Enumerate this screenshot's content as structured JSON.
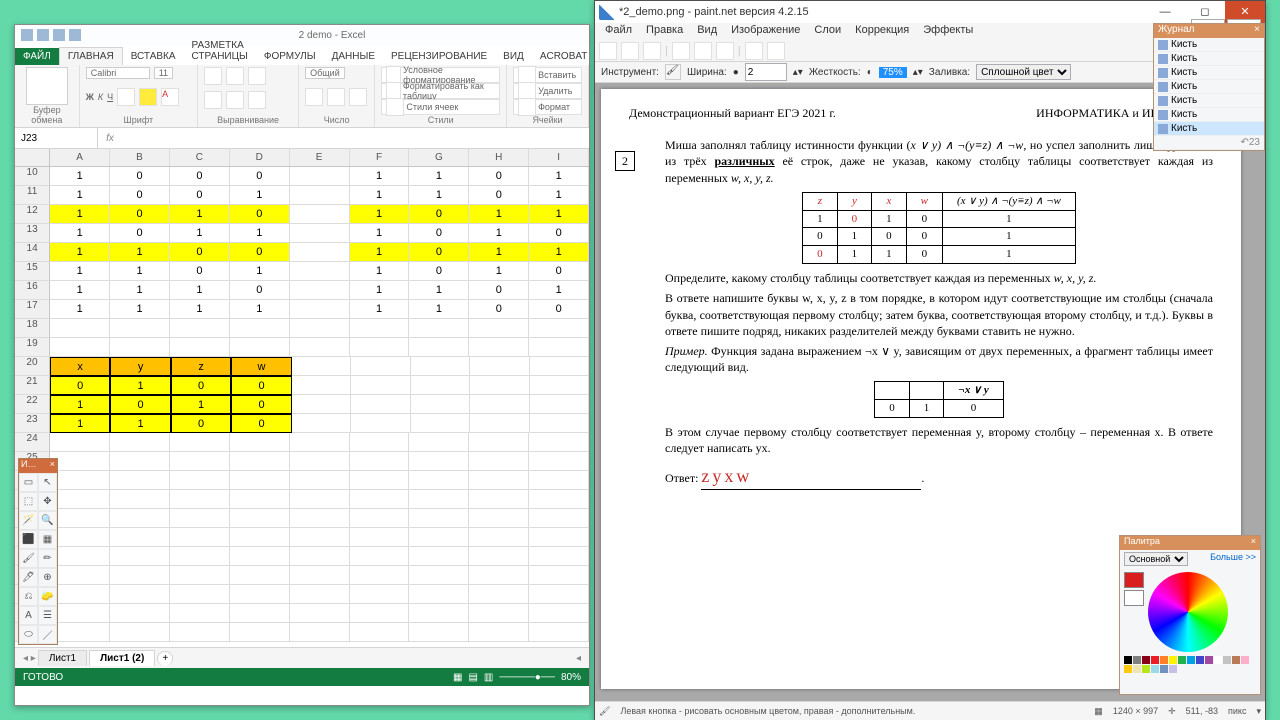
{
  "excel": {
    "title": "2 demo - Excel",
    "qat": [
      "save",
      "undo",
      "redo"
    ],
    "tabs": {
      "file": "ФАЙЛ",
      "items": [
        "ГЛАВНАЯ",
        "ВСТАВКА",
        "РАЗМЕТКА СТРАНИЦЫ",
        "ФОРМУЛЫ",
        "ДАННЫЕ",
        "РЕЦЕНЗИРОВАНИЕ",
        "ВИД",
        "ACROBAT"
      ],
      "active": 0
    },
    "ribbon": {
      "groups": [
        "Буфер обмена",
        "Шрифт",
        "Выравнивание",
        "Число",
        "Стили",
        "Ячейки"
      ],
      "font": "Calibri",
      "fontsize": "11",
      "numfmt": "Общий",
      "styles": [
        "Условное форматирование",
        "Форматировать как таблицу",
        "Стили ячеек"
      ],
      "cells": [
        "Вставить",
        "Удалить",
        "Формат"
      ]
    },
    "namebox": "J23",
    "formula": "",
    "cols": [
      "",
      "A",
      "B",
      "C",
      "D",
      "E",
      "F",
      "G",
      "H",
      "I"
    ],
    "rows_start": 10,
    "grid": [
      [
        "1",
        "0",
        "0",
        "0",
        "",
        "1",
        "1",
        "0",
        "1"
      ],
      [
        "1",
        "0",
        "0",
        "1",
        "",
        "1",
        "1",
        "0",
        "1"
      ],
      [
        "1",
        "0",
        "1",
        "0",
        "",
        "1",
        "0",
        "1",
        "1"
      ],
      [
        "1",
        "0",
        "1",
        "1",
        "",
        "1",
        "0",
        "1",
        "0"
      ],
      [
        "1",
        "1",
        "0",
        "0",
        "",
        "1",
        "0",
        "1",
        "1"
      ],
      [
        "1",
        "1",
        "0",
        "1",
        "",
        "1",
        "0",
        "1",
        "0"
      ],
      [
        "1",
        "1",
        "1",
        "0",
        "",
        "1",
        "1",
        "0",
        "1"
      ],
      [
        "1",
        "1",
        "1",
        "1",
        "",
        "1",
        "1",
        "0",
        "0"
      ],
      [
        "",
        "",
        "",
        "",
        "",
        "",
        "",
        "",
        ""
      ],
      [
        "",
        "",
        "",
        "",
        "",
        "",
        "",
        "",
        ""
      ],
      [
        "x",
        "y",
        "z",
        "w",
        "",
        "",
        "",
        "",
        ""
      ],
      [
        "0",
        "1",
        "0",
        "0",
        "",
        "",
        "",
        "",
        ""
      ],
      [
        "1",
        "0",
        "1",
        "0",
        "",
        "",
        "",
        "",
        ""
      ],
      [
        "1",
        "1",
        "0",
        "0",
        "",
        "",
        "",
        "",
        ""
      ]
    ],
    "yellow_rows": [
      2,
      4
    ],
    "yellow_block": {
      "from": 11,
      "to": 13,
      "cols": 4
    },
    "header_row": 10,
    "sheets": [
      "Лист1",
      "Лист1 (2)"
    ],
    "active_sheet": 1,
    "status": "ГОТОВО",
    "zoom": "80%"
  },
  "toolbox": {
    "title": "И…",
    "tools": [
      "▭",
      "↖",
      "⬚",
      "✥",
      "🪄",
      "🔍",
      "⬛",
      "▦",
      "🖌",
      "✏",
      "🖊",
      "⊕",
      "⎌",
      "🧽",
      "A",
      "☰",
      "⬭",
      "／"
    ]
  },
  "pdn": {
    "title": "*2_demo.png - paint.net версия 4.2.15",
    "menu": [
      "Файл",
      "Правка",
      "Вид",
      "Изображение",
      "Слои",
      "Коррекция",
      "Эффекты"
    ],
    "toolbar2": {
      "tool": "Инструмент:",
      "width_lbl": "Ширина:",
      "width": "2",
      "hard_lbl": "Жесткость:",
      "hard": "75%",
      "fill_lbl": "Заливка:",
      "fill": "Сплошной цвет"
    },
    "doc": {
      "left_hdr": "Демонстрационный вариант ЕГЭ 2021 г.",
      "right_hdr": "ИНФОРМАТИКА и ИКТ, 11 класс",
      "qnum": "2",
      "p1a": "Миша заполнял таблицу истинности функции (",
      "expr": "x ∨ y) ∧ ¬(y≡z) ∧ ¬w",
      "p1b": ", но успел заполнить лишь фрагмент из трёх ",
      "p1c": "различных",
      "p1d": " её строк, даже не указав, какому столбцу таблицы соответствует каждая из переменных ",
      "vars": "w, x, y, z.",
      "hand_hdr": [
        "z",
        "y",
        "x",
        "w"
      ],
      "truth_expr": "(x ∨ y) ∧ ¬(y≡z) ∧ ¬w",
      "truth": [
        [
          "1",
          "0",
          "1",
          "0",
          "1"
        ],
        [
          "0",
          "1",
          "0",
          "0",
          "1"
        ],
        [
          "0",
          "1",
          "1",
          "0",
          "1"
        ]
      ],
      "hand_row": [
        true,
        true,
        false,
        true,
        false
      ],
      "p2": "Определите, какому столбцу таблицы соответствует каждая из переменных ",
      "p2vars": "w, x, y, z.",
      "p3": "В ответе напишите буквы w, x, y, z в том порядке, в котором идут соответствующие им столбцы (сначала буква, соответствующая первому столбцу; затем буква, соответствующая второму столбцу, и т.д.). Буквы в ответе пишите подряд, никаких разделителей между буквами ставить не нужно.",
      "p4a": "Пример.",
      "p4b": " Функция задана выражением ¬x ∨ y, зависящим от двух переменных, а фрагмент таблицы имеет следующий вид.",
      "ex_expr": "¬x ∨ y",
      "ex": [
        [
          "",
          "",
          "¬x ∨ y"
        ],
        [
          "0",
          "1",
          "0"
        ]
      ],
      "p5": "В этом случае первому столбцу соответствует переменная y, второму столбцу – переменная x. В ответе следует написать yx.",
      "ans_lbl": "Ответ:",
      "ans": "zyxw"
    },
    "status": {
      "hint": "Левая кнопка - рисовать основным цветом, правая - дополнительным.",
      "size": "1240 × 997",
      "pos": "511, -83",
      "zoom": "пикс"
    },
    "history": {
      "title": "Журнал",
      "items": [
        "Кисть",
        "Кисть",
        "Кисть",
        "Кисть",
        "Кисть",
        "Кисть",
        "Кисть"
      ],
      "sel": 6,
      "undo": "↶23"
    },
    "palette": {
      "title": "Палитра",
      "mode": "Основной",
      "more": "Больше >>",
      "grid": [
        "#000",
        "#7f7f7f",
        "#880015",
        "#ed1c24",
        "#ff7f27",
        "#fff200",
        "#22b14c",
        "#00a2e8",
        "#3f48cc",
        "#a349a4",
        "#fff",
        "#c3c3c3",
        "#b97a57",
        "#ffaec9",
        "#ffc90e",
        "#efe4b0",
        "#b5e61d",
        "#99d9ea",
        "#7092be",
        "#c8bfe7"
      ]
    }
  }
}
